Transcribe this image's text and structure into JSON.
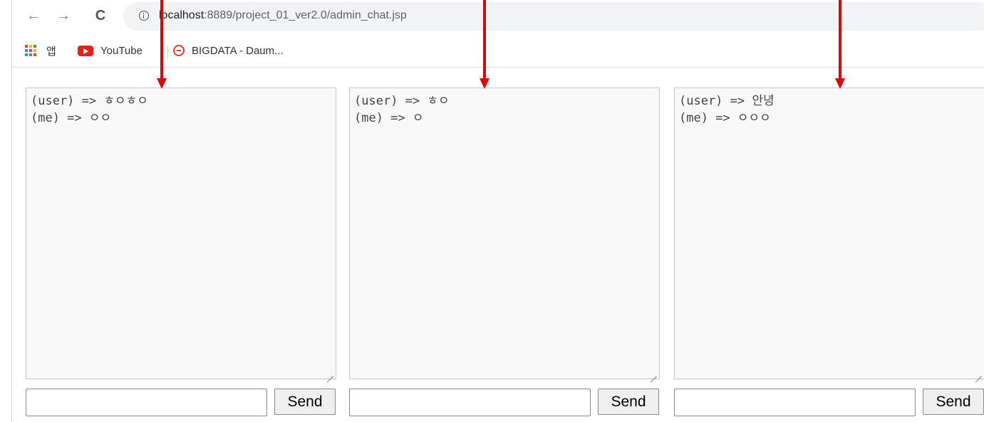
{
  "browser": {
    "url_host": "localhost",
    "url_path": ":8889/project_01_ver2.0/admin_chat.jsp",
    "back_icon": "←",
    "forward_icon": "→",
    "reload_icon": "C"
  },
  "bookmarks": {
    "apps_label": "앱",
    "youtube_label": "YouTube",
    "bigdata_label": "BIGDATA - Daum..."
  },
  "panels": [
    {
      "lines": [
        "(user) => ㅎㅇㅎㅇ",
        "(me) => ㅇㅇ"
      ],
      "input_value": "",
      "send_label": "Send"
    },
    {
      "lines": [
        "(user) => ㅎㅇ",
        "(me) => ㅇ"
      ],
      "input_value": "",
      "send_label": "Send"
    },
    {
      "lines": [
        "(user) => 안녕",
        "(me) => ㅇㅇㅇ"
      ],
      "input_value": "",
      "send_label": "Send"
    }
  ],
  "colors": {
    "annotation_arrow": "#e00000",
    "apps_grid": [
      "#ea4335",
      "#fbbc05",
      "#34a853",
      "#4285f4",
      "#ea4335",
      "#fbbc05",
      "#34a853",
      "#4285f4",
      "#ea4335"
    ]
  }
}
